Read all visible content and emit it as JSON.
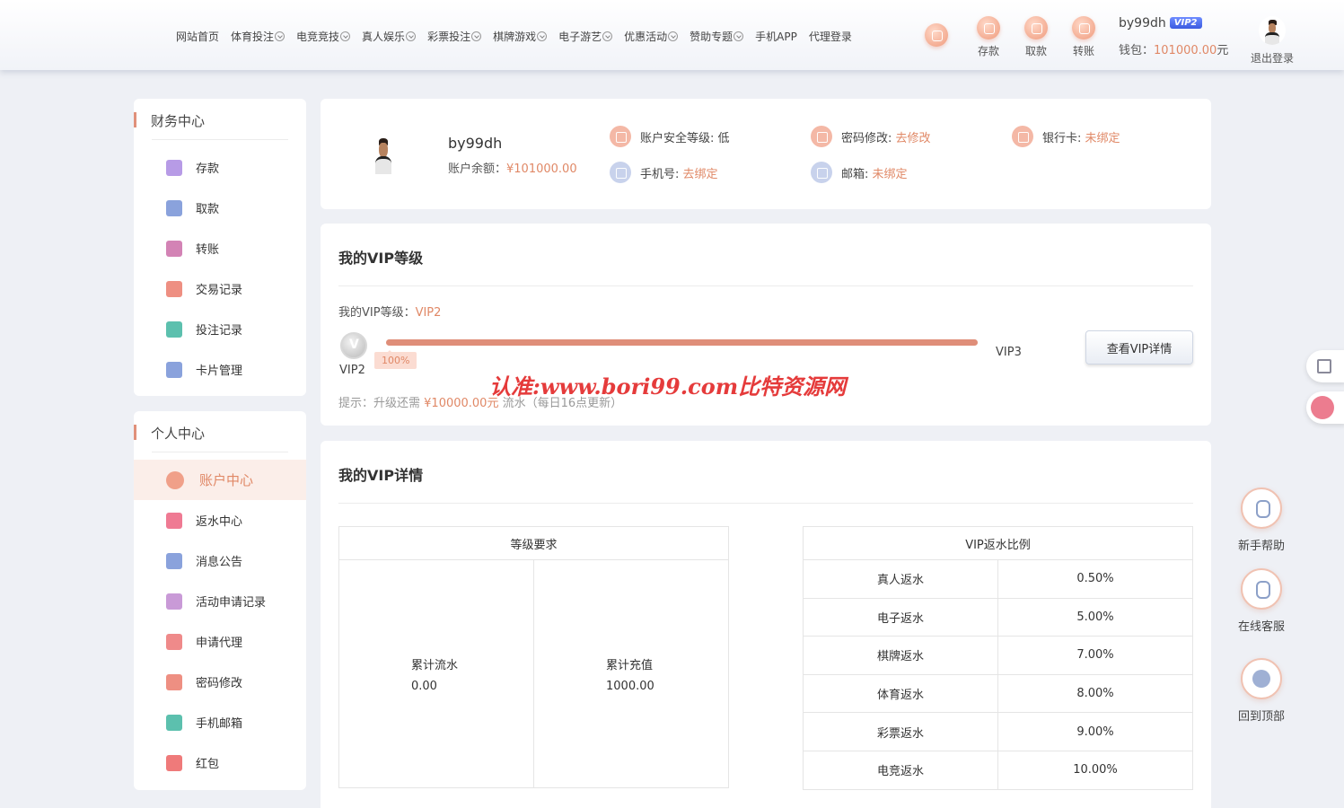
{
  "header": {
    "nav": [
      {
        "label": "网站首页",
        "dropdown": false
      },
      {
        "label": "体育投注",
        "dropdown": true
      },
      {
        "label": "电竞竞技",
        "dropdown": true
      },
      {
        "label": "真人娱乐",
        "dropdown": true
      },
      {
        "label": "彩票投注",
        "dropdown": true
      },
      {
        "label": "棋牌游戏",
        "dropdown": true
      },
      {
        "label": "电子游艺",
        "dropdown": true
      },
      {
        "label": "优惠活动",
        "dropdown": true
      },
      {
        "label": "赞助专题",
        "dropdown": true
      },
      {
        "label": "手机APP",
        "dropdown": false
      },
      {
        "label": "代理登录",
        "dropdown": false
      }
    ],
    "actions": {
      "deposit": "存款",
      "withdraw": "取款",
      "transfer": "转账"
    },
    "username": "by99dh",
    "vip_badge": "VIP2",
    "wallet_label": "钱包：",
    "wallet_amount": "101000.00",
    "wallet_unit": "元",
    "logout": "退出登录"
  },
  "sidebar": {
    "finance_title": "财务中心",
    "finance_items": [
      {
        "label": "存款",
        "icon": "wallet-icon",
        "color": "#b79be6"
      },
      {
        "label": "取款",
        "icon": "card-icon",
        "color": "#8aa2dc"
      },
      {
        "label": "转账",
        "icon": "transfer-icon",
        "color": "#d383b5"
      },
      {
        "label": "交易记录",
        "icon": "record-icon",
        "color": "#ee8f82"
      },
      {
        "label": "投注记录",
        "icon": "bet-record-icon",
        "color": "#5cc0ae"
      },
      {
        "label": "卡片管理",
        "icon": "card-manage-icon",
        "color": "#8aa2dc"
      }
    ],
    "personal_title": "个人中心",
    "personal_items": [
      {
        "label": "账户中心",
        "icon": "heart-icon",
        "color": "#f0a089",
        "active": true
      },
      {
        "label": "返水中心",
        "icon": "gift-icon",
        "color": "#ef7a93"
      },
      {
        "label": "消息公告",
        "icon": "bell-icon",
        "color": "#8aa2dc"
      },
      {
        "label": "活动申请记录",
        "icon": "user-record-icon",
        "color": "#c99ad7"
      },
      {
        "label": "申请代理",
        "icon": "agent-icon",
        "color": "#ef8a8a"
      },
      {
        "label": "密码修改",
        "icon": "lock-icon",
        "color": "#ee8f82"
      },
      {
        "label": "手机邮箱",
        "icon": "mail-icon",
        "color": "#5cc0ae"
      },
      {
        "label": "红包",
        "icon": "red-packet-icon",
        "color": "#ef7a7a"
      }
    ]
  },
  "account": {
    "username": "by99dh",
    "balance_label": "账户余额：",
    "balance": "¥101000.00",
    "security_label": "账户安全等级:",
    "security_value": "低",
    "password_label": "密码修改:",
    "password_link": "去修改",
    "bank_label": "银行卡:",
    "bank_link": "未绑定",
    "phone_label": "手机号:",
    "phone_link": "去绑定",
    "email_label": "邮箱:",
    "email_link": "未绑定"
  },
  "vip": {
    "title": "我的VIP等级",
    "level_label": "我的VIP等级：",
    "level": "VIP2",
    "current": "VIP2",
    "next": "VIP3",
    "progress_percent": 100,
    "progress_label": "100%",
    "details_button": "查看VIP详情",
    "hint_prefix": "提示：升级还需",
    "hint_amount": "¥10000.00元",
    "hint_suffix": "流水（每日16点更新）"
  },
  "watermark": "认准:www.bori99.com比特资源网",
  "vip_details": {
    "title": "我的VIP详情",
    "req_header": "等级要求",
    "req_cells": [
      {
        "label": "累计流水",
        "value": "0.00"
      },
      {
        "label": "累计充值",
        "value": "1000.00"
      }
    ],
    "rebate_header": "VIP返水比例",
    "rebate_rows": [
      {
        "label": "真人返水",
        "value": "0.50%"
      },
      {
        "label": "电子返水",
        "value": "5.00%"
      },
      {
        "label": "棋牌返水",
        "value": "7.00%"
      },
      {
        "label": "体育返水",
        "value": "8.00%"
      },
      {
        "label": "彩票返水",
        "value": "9.00%"
      },
      {
        "label": "电竞返水",
        "value": "10.00%"
      }
    ]
  },
  "floating": {
    "help": "新手帮助",
    "service": "在线客服",
    "top": "回到顶部"
  },
  "colors": {
    "accent": "#e08866",
    "vip_blue": "#3b5be0"
  }
}
